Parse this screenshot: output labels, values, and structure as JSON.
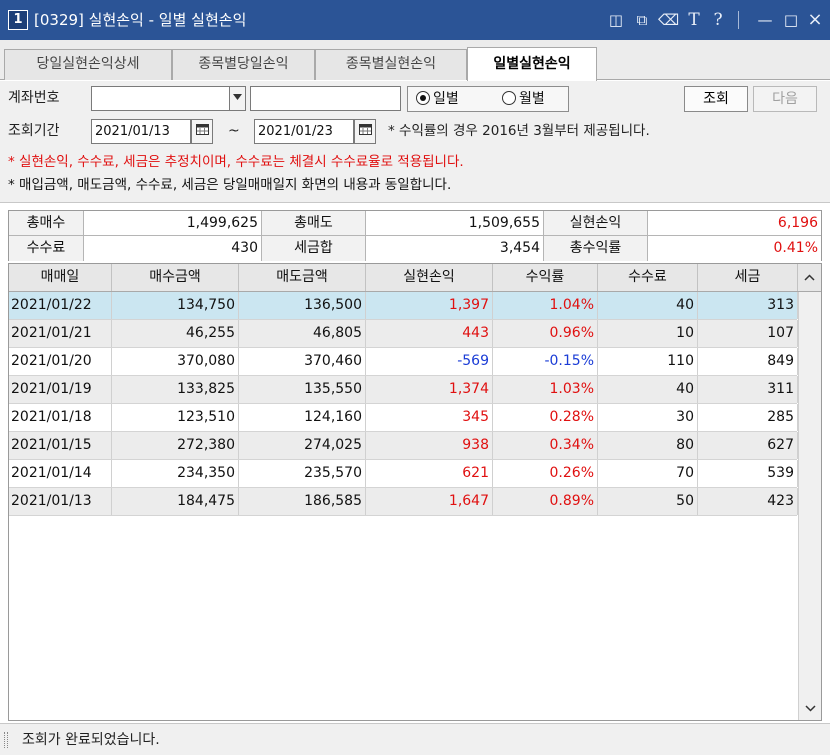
{
  "window": {
    "number": "1",
    "title": "[0329] 실현손익 - 일별 실현손익",
    "icons": [
      "pin-window-icon",
      "restore-copy-icon",
      "clear-format-icon",
      "text-size-icon",
      "help-icon",
      "minimize-icon",
      "maximize-icon",
      "close-icon"
    ],
    "icon_glyphs": {
      "pin": "◫",
      "copy": "⧉",
      "clear": "⌫",
      "text": "T",
      "help": "?",
      "min": "—",
      "max": "□",
      "close": "×"
    }
  },
  "tabs": [
    {
      "label": "당일실현손익상세",
      "active": false
    },
    {
      "label": "종목별당일손익",
      "active": false
    },
    {
      "label": "종목별실현손익",
      "active": false
    },
    {
      "label": "일별실현손익",
      "active": true
    }
  ],
  "filters": {
    "account_label": "계좌번호",
    "account_value": "",
    "account_name": "",
    "radio_daily": "일별",
    "radio_monthly": "월별",
    "radio_selected": "일별",
    "btn_search": "조회",
    "btn_next": "다음",
    "period_label": "조회기간",
    "date_from": "2021/01/13",
    "date_sep": "~",
    "date_to": "2021/01/23",
    "note_yield": "* 수익률의 경우 2016년 3월부터 제공됩니다.",
    "note_red": "* 실현손익, 수수료, 세금은 추정치이며, 수수료는 체결시 수수료율로 적용됩니다.",
    "note_black": "* 매입금액, 매도금액, 수수료, 세금은 당일매매일지 화면의 내용과 동일합니다."
  },
  "summary": {
    "total_buy_label": "총매수",
    "total_buy": "1,499,625",
    "total_sell_label": "총매도",
    "total_sell": "1,509,655",
    "realized_label": "실현손익",
    "realized": "6,196",
    "fee_label": "수수료",
    "fee": "430",
    "tax_label": "세금합",
    "tax": "3,454",
    "total_yield_label": "총수익률",
    "total_yield": "0.41%"
  },
  "grid": {
    "headers": [
      "매매일",
      "매수금액",
      "매도금액",
      "실현손익",
      "수익률",
      "수수료",
      "세금"
    ],
    "rows": [
      [
        "2021/01/22",
        "134,750",
        "136,500",
        "1,397",
        "1.04%",
        "40",
        "313"
      ],
      [
        "2021/01/21",
        "46,255",
        "46,805",
        "443",
        "0.96%",
        "10",
        "107"
      ],
      [
        "2021/01/20",
        "370,080",
        "370,460",
        "-569",
        "-0.15%",
        "110",
        "849"
      ],
      [
        "2021/01/19",
        "133,825",
        "135,550",
        "1,374",
        "1.03%",
        "40",
        "311"
      ],
      [
        "2021/01/18",
        "123,510",
        "124,160",
        "345",
        "0.28%",
        "30",
        "285"
      ],
      [
        "2021/01/15",
        "272,380",
        "274,025",
        "938",
        "0.34%",
        "80",
        "627"
      ],
      [
        "2021/01/14",
        "234,350",
        "235,570",
        "621",
        "0.26%",
        "70",
        "539"
      ],
      [
        "2021/01/13",
        "184,475",
        "186,585",
        "1,647",
        "0.89%",
        "50",
        "423"
      ]
    ],
    "selected_row": 0
  },
  "status": {
    "message": "조회가 완료되었습니다."
  },
  "colors": {
    "titlebar": "#2b5496",
    "positive": "#e01010",
    "negative": "#1a3cd6",
    "selected_row": "#cbe6f1"
  }
}
